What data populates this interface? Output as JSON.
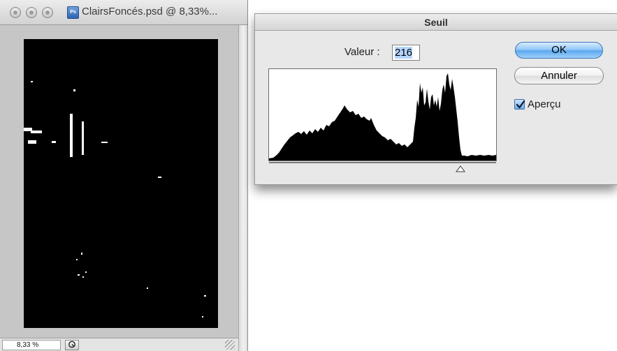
{
  "document_window": {
    "title": "ClairsFoncés.psd @ 8,33%...",
    "file_icon_label": "Ps",
    "zoom_value": "8,33 %"
  },
  "threshold_dialog": {
    "title": "Seuil",
    "value_label": "Valeur :",
    "value": "216",
    "ok_label": "OK",
    "cancel_label": "Annuler",
    "preview_label": "Aperçu",
    "preview_checked": true,
    "threshold_level": 216,
    "colors": {
      "ok_button": "#6ab2f2",
      "histogram": "#000000"
    }
  }
}
